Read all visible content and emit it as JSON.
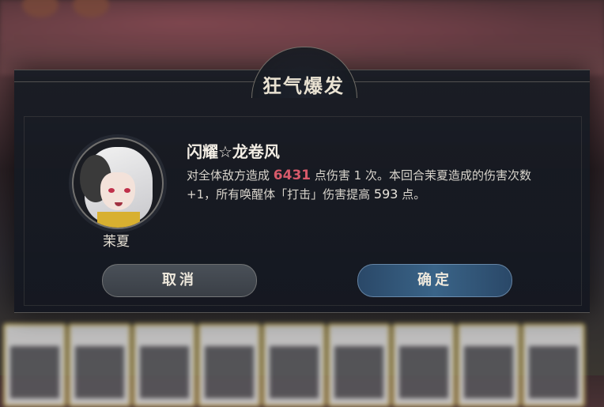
{
  "dialog": {
    "title": "狂气爆发",
    "character_name": "茉夏",
    "skill_name": "闪耀☆龙卷风",
    "description": {
      "part1": "对全体敌方造成 ",
      "damage_value": "6431",
      "part2": " 点伤害 1 次。本回合茉夏造成的伤害次数 +1，所有唤醒体「打击」伤害提高 ",
      "bonus_value": "593",
      "part3": " 点。"
    },
    "buttons": {
      "cancel_label": "取消",
      "confirm_label": "确定"
    }
  },
  "colors": {
    "highlight": "#d65a6a",
    "confirm_accent": "#3a6488"
  },
  "icons": {
    "avatar": "character-portrait"
  }
}
